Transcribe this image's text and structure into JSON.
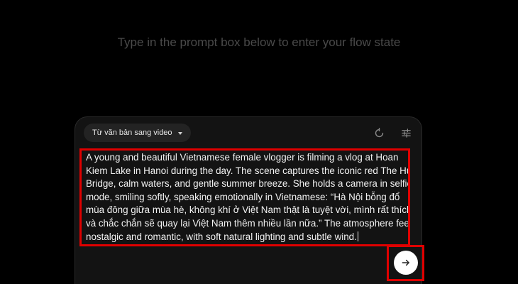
{
  "headline": "Type in the prompt box below to enter your flow state",
  "mode_selector": {
    "selected": "Từ văn bản sang video",
    "icon": "chevron-down-icon"
  },
  "toolbar": {
    "refresh_icon": "refresh-icon",
    "settings_icon": "sliders-icon"
  },
  "prompt": {
    "lines": [
      "A young and beautiful Vietnamese female vlogger is filming a vlog at Hoan",
      "Kiem Lake in Hanoi during the day. The scene captures the iconic red The Huc",
      "Bridge, calm waters, and gentle summer breeze. She holds a camera in selfie",
      "mode, smiling softly, speaking emotionally in Vietnamese: “Hà Nội bỗng đổ",
      "mùa đông giữa mùa hè, không khí ở Việt Nam thật là tuyệt vời, mình rất thích",
      "và chắc chắn sẽ quay lại Việt Nam thêm nhiều lần nữa.” The atmosphere feels",
      "nostalgic and romantic, with soft natural lighting and subtle wind."
    ]
  },
  "send": {
    "icon": "arrow-right-icon"
  },
  "colors": {
    "background": "#000000",
    "card": "#131313",
    "highlight": "#e00000",
    "send_button": "#ffffff"
  }
}
